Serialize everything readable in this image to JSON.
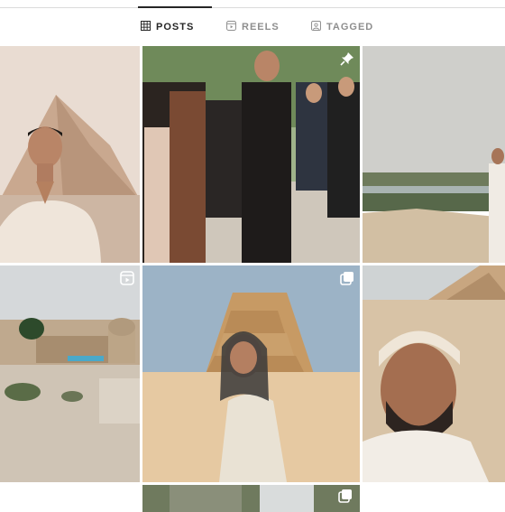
{
  "tabs": [
    {
      "label": "POSTS",
      "icon": "grid-icon",
      "active": true
    },
    {
      "label": "REELS",
      "icon": "reels-icon",
      "active": false
    },
    {
      "label": "TAGGED",
      "icon": "tagged-icon",
      "active": false
    }
  ],
  "posts": [
    {
      "id": "post-1",
      "badge": null
    },
    {
      "id": "post-2",
      "badge": "pin-icon"
    },
    {
      "id": "post-3",
      "badge": null
    },
    {
      "id": "post-4",
      "badge": "reel-icon"
    },
    {
      "id": "post-5",
      "badge": "carousel-icon"
    },
    {
      "id": "post-6",
      "badge": null
    },
    {
      "id": "post-7",
      "badge": null
    },
    {
      "id": "post-8",
      "badge": "carousel-icon"
    },
    {
      "id": "post-9",
      "badge": null
    }
  ],
  "colors": {
    "tab_active": "#262626",
    "tab_inactive": "#8e8e8e",
    "divider": "#dbdbdb"
  }
}
